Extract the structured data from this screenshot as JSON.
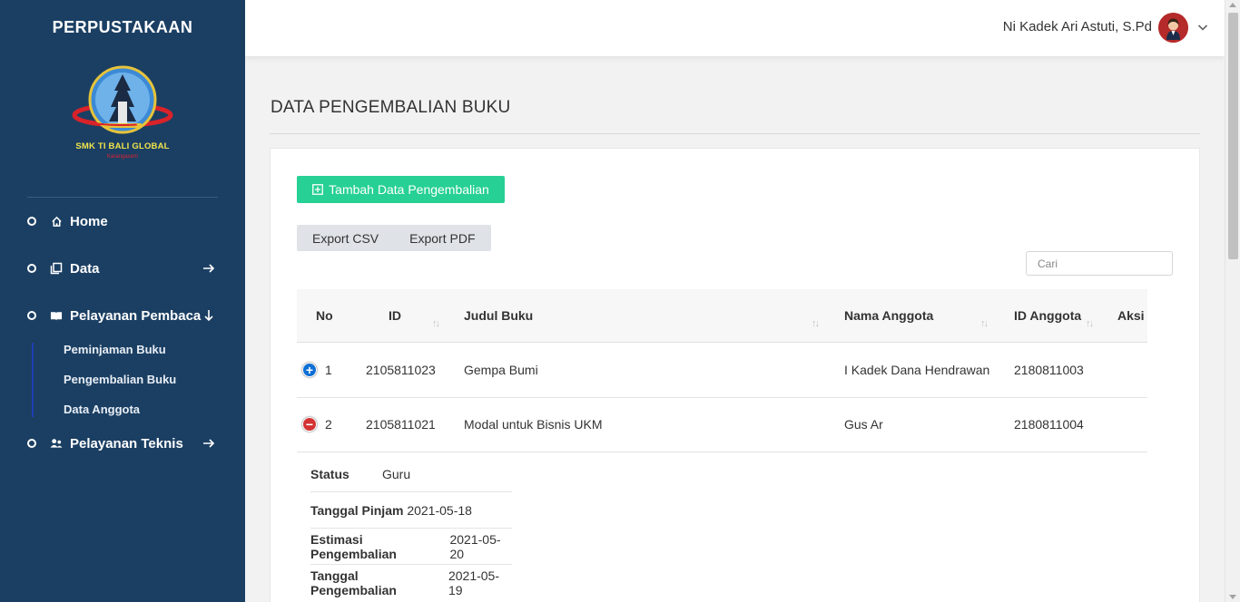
{
  "sidebar": {
    "brand": "PERPUSTAKAAN",
    "logo_text": "SMK TI BALI GLOBAL",
    "logo_sub": "Karangasem",
    "items": [
      {
        "label": "Home",
        "icon": "home-icon"
      },
      {
        "label": "Data",
        "icon": "copy-icon",
        "arrow": "arrow-right-icon"
      },
      {
        "label": "Pelayanan Pembaca",
        "icon": "book-open-icon",
        "arrow": "arrow-down-icon"
      },
      {
        "label": "Pelayanan Teknis",
        "icon": "user-group-icon",
        "arrow": "arrow-right-icon"
      }
    ],
    "subitems": [
      {
        "label": "Peminjaman Buku"
      },
      {
        "label": "Pengembalian Buku"
      },
      {
        "label": "Data Anggota"
      }
    ]
  },
  "topbar": {
    "user_name": "Ni Kadek Ari Astuti, S.Pd"
  },
  "main": {
    "title": "DATA PENGEMBALIAN BUKU",
    "add_button": "Tambah Data Pengembalian",
    "export_csv": "Export CSV",
    "export_pdf": "Export PDF",
    "search_placeholder": "Cari",
    "columns": [
      "No",
      "ID",
      "Judul Buku",
      "Nama Anggota",
      "ID Anggota",
      "Aksi"
    ],
    "rows": [
      {
        "no": "1",
        "id": "2105811023",
        "judul": "Gempa Bumi",
        "nama": "I Kadek Dana Hendrawan",
        "id_anggota": "2180811003",
        "expanded": false
      },
      {
        "no": "2",
        "id": "2105811021",
        "judul": "Modal untuk Bisnis UKM",
        "nama": "Gus Ar",
        "id_anggota": "2180811004",
        "expanded": true
      }
    ],
    "detail": [
      {
        "label": "Status",
        "value": "Guru"
      },
      {
        "label": "Tanggal Pinjam",
        "value": "2021-05-18"
      },
      {
        "label": "Estimasi Pengembalian",
        "value": "2021-05-20"
      },
      {
        "label": "Tanggal Pengembalian",
        "value": "2021-05-19"
      }
    ]
  },
  "colors": {
    "sidebar_bg": "#1b3f63",
    "accent_green": "#27d095",
    "expand_blue": "#0d6fd4",
    "collapse_red": "#d33333"
  }
}
